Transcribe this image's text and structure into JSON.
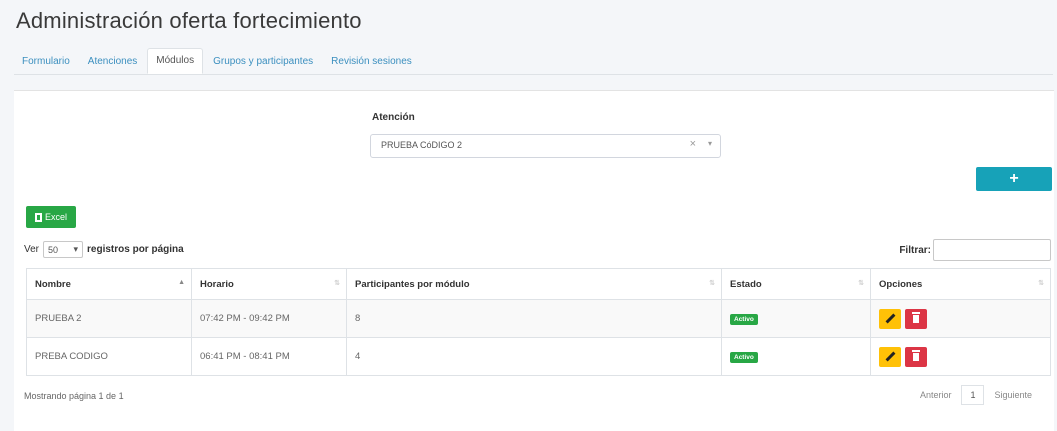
{
  "page": {
    "title": "Administración oferta fortecimiento"
  },
  "tabs": [
    {
      "label": "Formulario"
    },
    {
      "label": "Atenciones"
    },
    {
      "label": "Módulos"
    },
    {
      "label": "Grupos y participantes"
    },
    {
      "label": "Revisión sesiones"
    }
  ],
  "active_tab": "Módulos",
  "filter_form": {
    "label": "Atención",
    "selected": "PRUEBA CóDIGO 2",
    "clear_glyph": "×",
    "chevron_glyph": "▾"
  },
  "add_button": {
    "label": "+"
  },
  "excel_button": {
    "label": "Excel",
    "icon": "file-excel-icon"
  },
  "length": {
    "prefix": "Ver",
    "value": "50",
    "suffix": "registros por página"
  },
  "search": {
    "label": "Filtrar:",
    "value": ""
  },
  "table": {
    "columns": [
      "Nombre",
      "Horario",
      "Participantes por módulo",
      "Estado",
      "Opciones"
    ],
    "sorted_column": "Nombre",
    "rows": [
      {
        "nombre": "PRUEBA 2",
        "horario": "07:42 PM - 09:42 PM",
        "participantes": "8",
        "estado": "Activo"
      },
      {
        "nombre": "PREBA CODIGO",
        "horario": "06:41 PM - 08:41 PM",
        "participantes": "4",
        "estado": "Activo"
      }
    ]
  },
  "footer": {
    "info": "Mostrando página 1 de 1",
    "prev": "Anterior",
    "page": "1",
    "next": "Siguiente"
  },
  "colors": {
    "primary_link": "#3b8fbf",
    "add_button": "#17a2b8",
    "excel_button": "#28a745",
    "badge_active": "#28a745",
    "edit_button": "#ffc107",
    "delete_button": "#dc3545"
  }
}
